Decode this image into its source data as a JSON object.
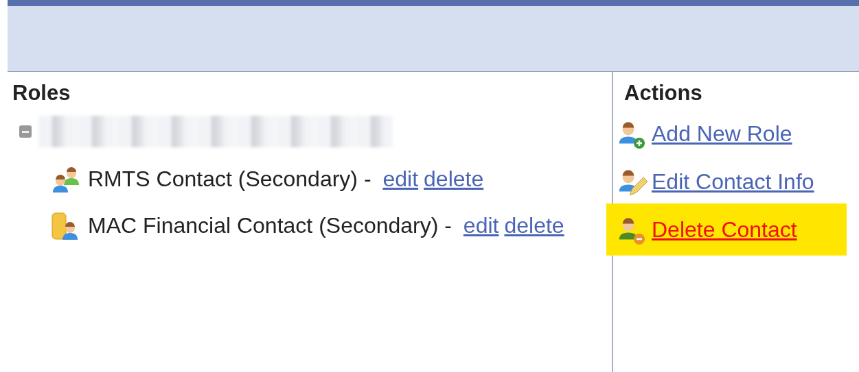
{
  "roles_panel": {
    "title": "Roles",
    "root": {
      "expanded": true,
      "children": [
        {
          "kind": "people",
          "label": "RMTS Contact (Secondary) - ",
          "links": [
            "edit",
            "delete"
          ]
        },
        {
          "kind": "coins",
          "label": "MAC Financial Contact (Secondary) - ",
          "links": [
            "edit",
            "delete"
          ]
        }
      ]
    }
  },
  "actions_panel": {
    "title": "Actions",
    "items": [
      {
        "kind": "add",
        "label": "Add New Role",
        "highlighted": false
      },
      {
        "kind": "edit",
        "label": "Edit Contact Info",
        "highlighted": false
      },
      {
        "kind": "delete",
        "label": "Delete Contact",
        "highlighted": true
      }
    ]
  }
}
